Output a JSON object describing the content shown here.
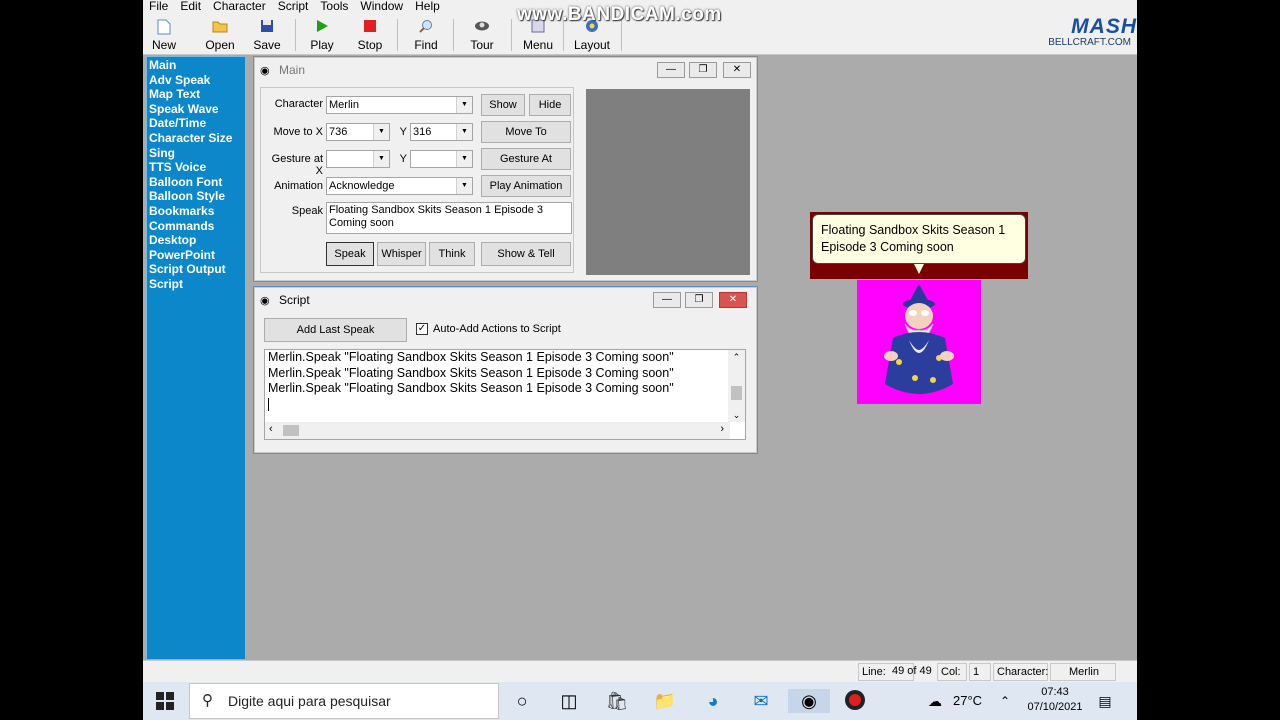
{
  "menubar": [
    "File",
    "Edit",
    "Character",
    "Script",
    "Tools",
    "Window",
    "Help"
  ],
  "toolbar": {
    "buttons": [
      {
        "label": "New",
        "icon": "new-file-icon"
      },
      {
        "label": "Open",
        "icon": "open-folder-icon"
      },
      {
        "label": "Save",
        "icon": "save-disk-icon"
      },
      {
        "label": "Play",
        "icon": "play-icon"
      },
      {
        "label": "Stop",
        "icon": "stop-icon"
      },
      {
        "label": "Find",
        "icon": "find-icon"
      },
      {
        "label": "Tour",
        "icon": "tour-icon"
      },
      {
        "label": "Menu",
        "icon": "menu-icon"
      },
      {
        "label": "Layout",
        "icon": "layout-icon"
      }
    ],
    "logo_text": "MASH",
    "logo_sub": "BELLCRAFT.COM"
  },
  "watermark": "www.BANDICAM.com",
  "leftnav": [
    "Main",
    "Adv Speak",
    "Map Text",
    "Speak Wave",
    "Date/Time",
    "Character Size",
    "Sing",
    "TTS Voice",
    "Balloon Font",
    "Balloon Style",
    "Bookmarks",
    "Commands",
    "Desktop",
    "PowerPoint",
    "Script Output",
    "Script"
  ],
  "main_window": {
    "title": "Main",
    "character_label": "Character",
    "character_value": "Merlin",
    "show_button": "Show",
    "hide_button": "Hide",
    "move_to_x_label": "Move to X",
    "move_x_value": "736",
    "y_label": "Y",
    "move_y_value": "316",
    "move_to_button": "Move To",
    "gesture_at_x_label": "Gesture at X",
    "gesture_at_button": "Gesture At",
    "animation_label": "Animation",
    "animation_value": "Acknowledge",
    "play_animation_button": "Play Animation",
    "speak_label": "Speak",
    "speak_text": "Floating Sandbox Skits Season 1 Episode 3 Coming soon",
    "speak_button": "Speak",
    "whisper_button": "Whisper",
    "think_button": "Think",
    "show_tell_button": "Show & Tell"
  },
  "script_window": {
    "title": "Script",
    "add_last_speak_button": "Add Last Speak",
    "auto_add_label": "Auto-Add Actions to Script",
    "auto_add_checked": true,
    "lines": [
      "Merlin.Speak \"Floating Sandbox Skits Season 1 Episode 3 Coming soon\"",
      "Merlin.Speak \"Floating Sandbox Skits Season 1 Episode 3 Coming soon\"",
      "Merlin.Speak \"Floating Sandbox Skits Season 1 Episode 3 Coming soon\""
    ]
  },
  "balloon_text": "Floating Sandbox Skits Season 1 Episode 3 Coming soon",
  "statusbar": {
    "line_label": "Line:",
    "line_value": "49 of 49",
    "col_label": "Col:",
    "col_value": "1",
    "character_label": "Character:",
    "character_value": "Merlin"
  },
  "taskbar": {
    "search_placeholder": "Digite aqui para pesquisar",
    "weather": "27°C",
    "time": "07:43",
    "date": "07/10/2021"
  },
  "colors": {
    "leftnav_bg": "#0c87c9",
    "desktop_bg": "#ababab",
    "agent_bg": "#ff00ff",
    "balloon_border": "#7a0000",
    "balloon_fill": "#ffffe1"
  }
}
